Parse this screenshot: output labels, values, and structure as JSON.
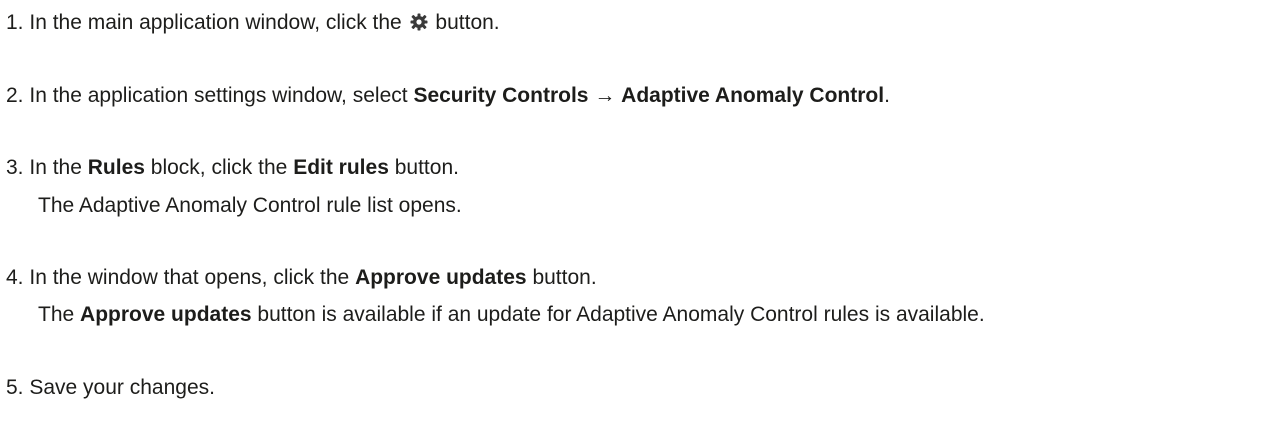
{
  "steps": [
    {
      "number": "1.",
      "before": "In the main application window, click the",
      "icon": "gear-icon",
      "after": "button."
    },
    {
      "number": "2.",
      "before": "In the application settings window, select",
      "bold1": "Security Controls",
      "arrow": "→",
      "bold2": "Adaptive Anomaly Control",
      "after": "."
    },
    {
      "number": "3.",
      "before": "In the",
      "bold1": "Rules",
      "middle": "block, click the",
      "bold2": "Edit rules",
      "after": "button.",
      "note": "The Adaptive Anomaly Control rule list opens."
    },
    {
      "number": "4.",
      "before": "In the window that opens, click the",
      "bold1": "Approve updates",
      "after": "button.",
      "note_before": "The",
      "note_bold": "Approve updates",
      "note_after": "button is available if an update for Adaptive Anomaly Control rules is available."
    },
    {
      "number": "5.",
      "text": "Save your changes."
    }
  ]
}
